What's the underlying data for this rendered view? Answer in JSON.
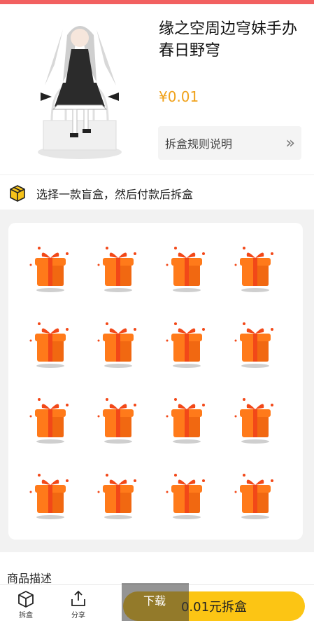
{
  "product": {
    "title": "缘之空周边穹妹手办春日野穹",
    "price": "¥0.01"
  },
  "rules_button": {
    "label": "拆盒规则说明",
    "chevron": "»"
  },
  "hint": {
    "text": "选择一款盲盒，然后付款后拆盒"
  },
  "boxes": {
    "rows": 4,
    "cols": 4,
    "colors": {
      "primary": "#ff7a1a",
      "dark": "#e85b0c",
      "ribbon": "#f24818",
      "shadow": "#cfcfcf"
    }
  },
  "description": {
    "title": "商品描述"
  },
  "bottom_bar": {
    "left_items": [
      {
        "label": "拆盒",
        "icon": "cube-icon"
      },
      {
        "label": "分享",
        "icon": "share-icon"
      }
    ],
    "overlay_label": "下载",
    "primary_button": "0.01元拆盒"
  },
  "colors": {
    "accent_red": "#f26060",
    "price": "#f0a21b",
    "button": "#fcc514"
  }
}
